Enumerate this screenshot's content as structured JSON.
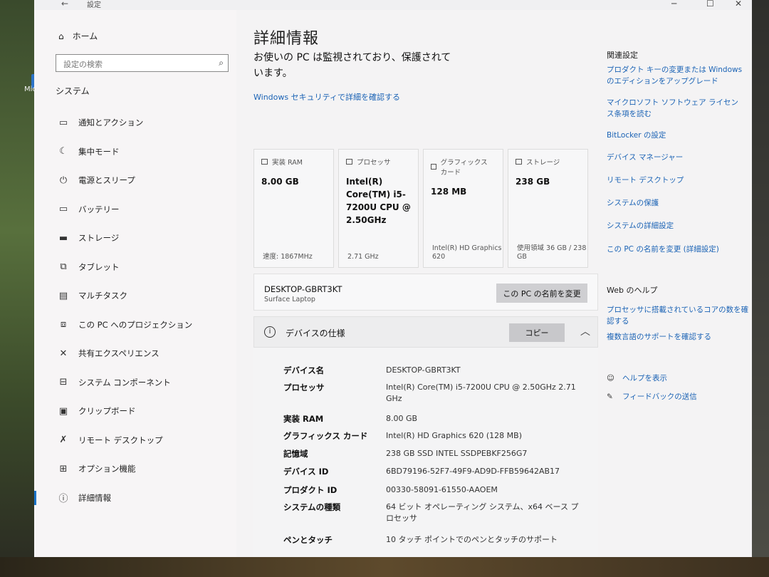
{
  "window": {
    "title": "設定",
    "back": "←",
    "minimize": "─",
    "maximize": "☐",
    "close": "✕"
  },
  "desktop": {
    "icon_label": "Micros"
  },
  "sidebar": {
    "home": "ホーム",
    "search_placeholder": "設定の検索",
    "section": "システム",
    "items": [
      {
        "label": "通知とアクション",
        "icon": "notification-icon"
      },
      {
        "label": "集中モード",
        "icon": "moon-icon"
      },
      {
        "label": "電源とスリープ",
        "icon": "power-icon"
      },
      {
        "label": "バッテリー",
        "icon": "battery-icon"
      },
      {
        "label": "ストレージ",
        "icon": "storage-icon"
      },
      {
        "label": "タブレット",
        "icon": "tablet-icon"
      },
      {
        "label": "マルチタスク",
        "icon": "multitask-icon"
      },
      {
        "label": "この PC へのプロジェクション",
        "icon": "projection-icon"
      },
      {
        "label": "共有エクスペリエンス",
        "icon": "shared-icon"
      },
      {
        "label": "システム コンポーネント",
        "icon": "component-icon"
      },
      {
        "label": "クリップボード",
        "icon": "clipboard-icon"
      },
      {
        "label": "リモート デスクトップ",
        "icon": "remote-icon"
      },
      {
        "label": "オプション機能",
        "icon": "options-icon"
      },
      {
        "label": "詳細情報",
        "icon": "info-icon"
      }
    ]
  },
  "main": {
    "title": "詳細情報",
    "protect_text": "お使いの PC は監視されており、保護されています。",
    "security_link": "Windows セキュリティで詳細を確認する",
    "cards": [
      {
        "label": "実装 RAM",
        "value": "8.00 GB",
        "foot": "速度: 1867MHz"
      },
      {
        "label": "プロセッサ",
        "value": "Intel(R) Core(TM) i5-7200U CPU @ 2.50GHz",
        "foot": "2.71 GHz"
      },
      {
        "label": "グラフィックス カード",
        "value": "128 MB",
        "foot": "Intel(R) HD Graphics 620"
      },
      {
        "label": "ストレージ",
        "value": "238 GB",
        "foot": "使用領域 36 GB / 238 GB"
      }
    ],
    "device_name": "DESKTOP-GBRT3KT",
    "device_model": "Surface Laptop",
    "rename_button": "この PC の名前を変更",
    "spec_title": "デバイスの仕様",
    "copy_button": "コピー",
    "specs": [
      {
        "k": "デバイス名",
        "v": "DESKTOP-GBRT3KT"
      },
      {
        "k": "プロセッサ",
        "v": "Intel(R) Core(TM) i5-7200U CPU @ 2.50GHz 2.71 GHz"
      },
      {
        "k": "実装 RAM",
        "v": "8.00 GB"
      },
      {
        "k": "グラフィックス カード",
        "v": "Intel(R) HD Graphics 620 (128 MB)"
      },
      {
        "k": "記憶域",
        "v": "238 GB SSD INTEL SSDPEBKF256G7"
      },
      {
        "k": "デバイス ID",
        "v": "6BD79196-52F7-49F9-AD9D-FFB59642AB17"
      },
      {
        "k": "プロダクト ID",
        "v": "00330-58091-61550-AAOEM"
      },
      {
        "k": "システムの種類",
        "v": "64 ビット オペレーティング システム、x64 ベース プロセッサ"
      },
      {
        "k": "ペンとタッチ",
        "v": "10 タッチ ポイントでのペンとタッチのサポート"
      }
    ]
  },
  "rail": {
    "related": "関連設定",
    "links": [
      "プロダクト キーの変更または Windows のエディションをアップグレード",
      "マイクロソフト ソフトウェア ライセンス条項を読む",
      "BitLocker の設定",
      "デバイス マネージャー",
      "リモート デスクトップ",
      "システムの保護",
      "システムの詳細設定",
      "この PC の名前を変更 (詳細設定)"
    ],
    "web_help": "Web のヘルプ",
    "help_links": [
      "プロセッサに搭載されているコアの数を確認する",
      "複数言語のサポートを確認する"
    ],
    "show_help": "ヘルプを表示",
    "feedback": "フィードバックの送信"
  }
}
